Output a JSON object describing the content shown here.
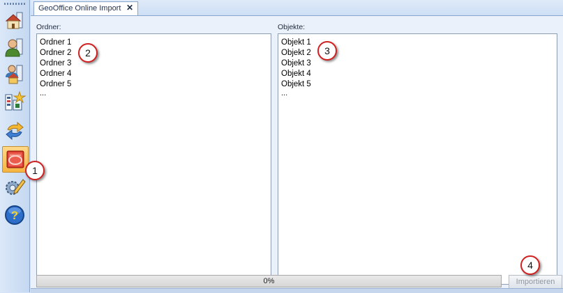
{
  "tab": {
    "title": "GeoOffice Online Import",
    "close": "✕"
  },
  "toolbar": {
    "items": [
      {
        "icon": "house-map-icon"
      },
      {
        "icon": "user-profile-icon"
      },
      {
        "icon": "user-house-icon"
      },
      {
        "icon": "layout-star-icon"
      },
      {
        "icon": "sync-arrows-icon"
      },
      {
        "icon": "import-active-icon"
      },
      {
        "icon": "settings-pencil-icon"
      },
      {
        "icon": "help-icon"
      }
    ]
  },
  "folders": {
    "label": "Ordner:",
    "items": [
      "Ordner 1",
      "Ordner 2",
      "Ordner 3",
      "Ordner 4",
      "Ordner 5"
    ],
    "more": "..."
  },
  "objects": {
    "label": "Objekte:",
    "items": [
      "Objekt 1",
      "Objekt 2",
      "Objekt 3",
      "Objekt 4",
      "Objekt 5"
    ],
    "more": "..."
  },
  "progress": {
    "value": 0,
    "text": "0%"
  },
  "import_button": {
    "label": "Importieren",
    "enabled": false
  },
  "callouts": [
    "1",
    "2",
    "3",
    "4"
  ],
  "colors": {
    "callout_ring": "#d02020",
    "active_tool": "#f6b543",
    "chrome": "#d4e3f7"
  }
}
